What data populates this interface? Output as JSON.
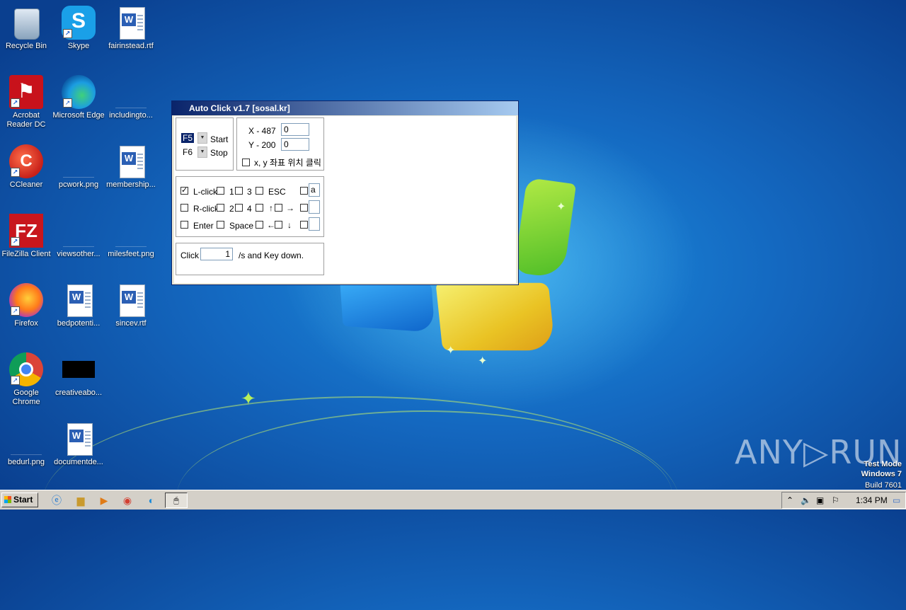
{
  "desktop": {
    "icons": [
      {
        "label": "Recycle Bin"
      },
      {
        "label": "Skype"
      },
      {
        "label": "fairinstead.rtf"
      },
      {
        "label": "Acrobat Reader DC"
      },
      {
        "label": "Microsoft Edge"
      },
      {
        "label": "includingto..."
      },
      {
        "label": "CCleaner"
      },
      {
        "label": "pcwork.png"
      },
      {
        "label": "membership..."
      },
      {
        "label": "FileZilla Client"
      },
      {
        "label": "viewsother..."
      },
      {
        "label": "milesfeet.png"
      },
      {
        "label": "Firefox"
      },
      {
        "label": "bedpotenti..."
      },
      {
        "label": "sincev.rtf"
      },
      {
        "label": "Google Chrome"
      },
      {
        "label": "creativeabo..."
      },
      {
        "label": "bedurl.png"
      },
      {
        "label": "documentde..."
      }
    ]
  },
  "window": {
    "title": "Auto Click v1.7    [sosal.kr]",
    "hotkeys": {
      "start_key": "F5",
      "start_label": "Start",
      "stop_key": "F6",
      "stop_label": "Stop"
    },
    "coords": {
      "x_label": "X - 487",
      "x_value": "0",
      "y_label": "Y - 200",
      "y_value": "0",
      "pos_click_label": "x, y 좌표 위치 클릭"
    },
    "keys": {
      "lclick": "L-click",
      "rclick": "R-click",
      "enter": "Enter",
      "one": "1",
      "two": "2",
      "three": "3",
      "four": "4",
      "space": "Space",
      "esc": "ESC",
      "up": "↑",
      "right": "→",
      "left": "←",
      "down": "↓",
      "custom1_value": "a",
      "custom2_value": "",
      "custom3_value": ""
    },
    "rate": {
      "click_label": "Click",
      "value": "1",
      "unit_label": "/s  and Key down."
    }
  },
  "taskbar": {
    "start_label": "Start",
    "clock": "1:34 PM"
  },
  "watermark": {
    "brand": "ANY▷RUN",
    "line1": "Test Mode",
    "line2": "Windows 7",
    "line3": "Build 7601"
  }
}
